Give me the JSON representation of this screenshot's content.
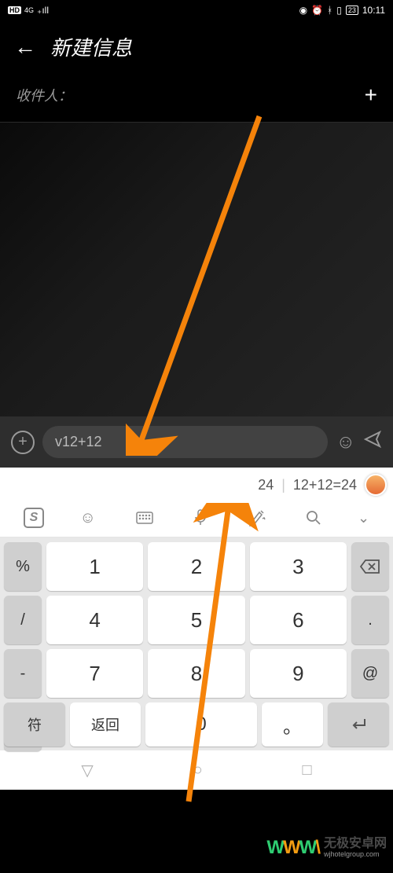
{
  "status": {
    "hd": "HD",
    "network": "4G",
    "time": "10:11",
    "battery": "23"
  },
  "header": {
    "title": "新建信息"
  },
  "recipient": {
    "label": "收件人："
  },
  "input": {
    "text": "v12+12"
  },
  "suggestions": {
    "result": "24",
    "equation": "12+12=24"
  },
  "keyboard": {
    "rows": [
      {
        "side": "%",
        "n1": "1",
        "n2": "2",
        "n3": "3",
        "right_icon": "backspace"
      },
      {
        "side": "/",
        "n1": "4",
        "n2": "5",
        "n3": "6",
        "right": "."
      },
      {
        "side": "-",
        "n1": "7",
        "n2": "8",
        "n3": "9",
        "right": "@"
      },
      {
        "side": "+"
      }
    ],
    "bottom": {
      "fu": "符",
      "ret": "返回",
      "zero": "0",
      "dot": "。"
    }
  },
  "watermark": {
    "cn": "无极安卓网",
    "en": "wjhotelgroup.com"
  }
}
